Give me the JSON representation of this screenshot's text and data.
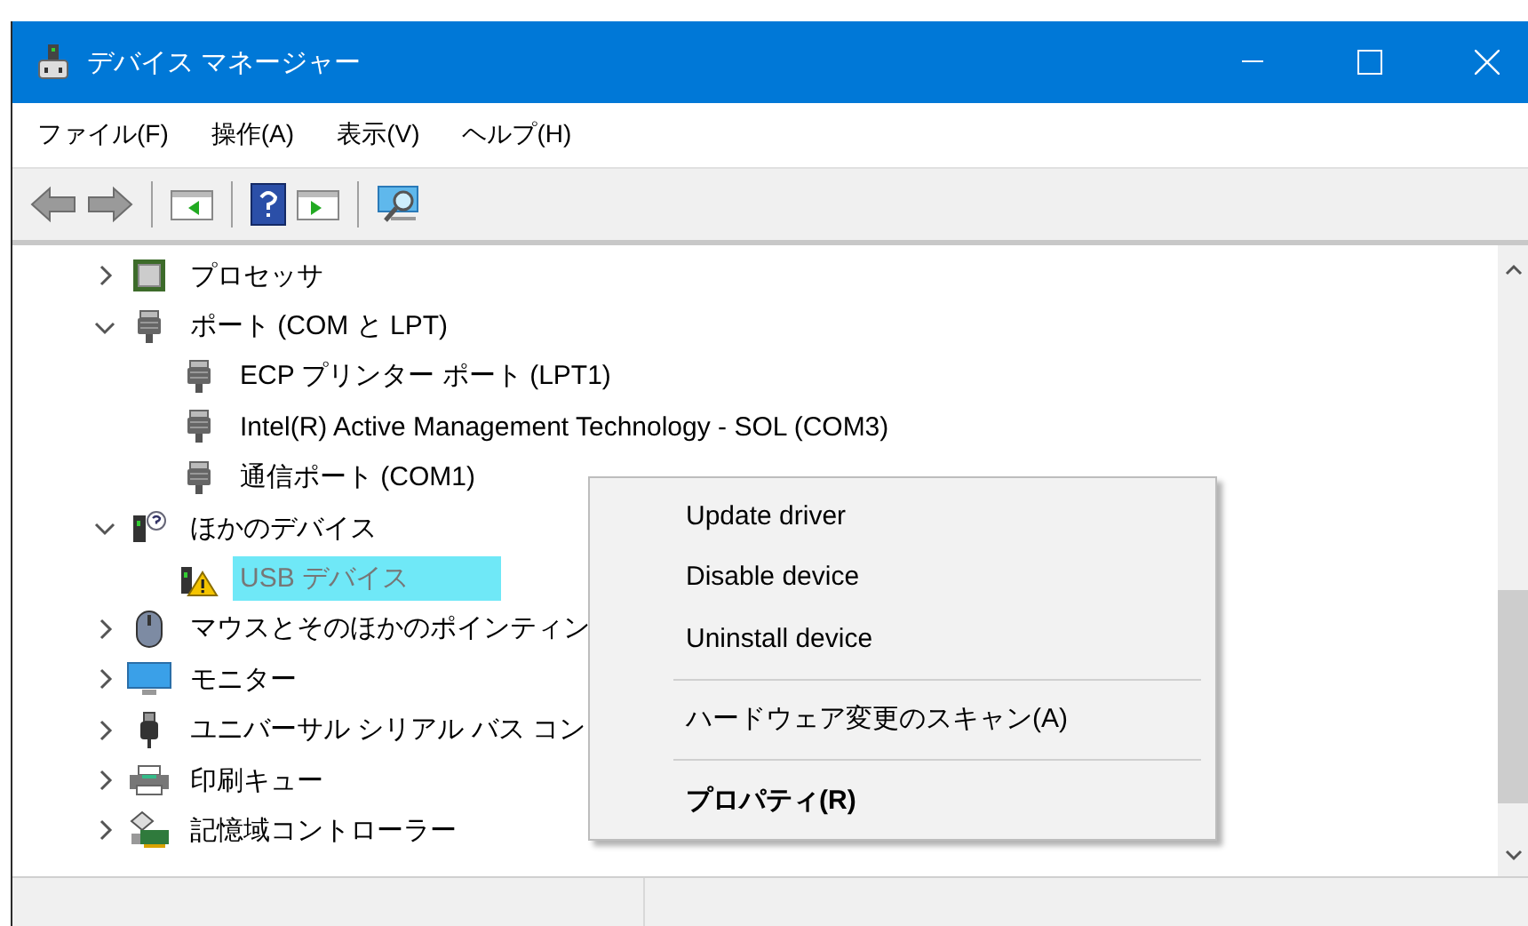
{
  "window": {
    "title": "デバイス マネージャー"
  },
  "menu_bar": [
    {
      "label": "ファイル(F)"
    },
    {
      "label": "操作(A)"
    },
    {
      "label": "表示(V)"
    },
    {
      "label": "ヘルプ(H)"
    }
  ],
  "tree": [
    {
      "label": "プロセッサ",
      "expanded": false,
      "selected": false
    },
    {
      "label": "ポート (COM と LPT)",
      "expanded": true,
      "selected": false,
      "children": [
        {
          "label": "ECP プリンター ポート (LPT1)",
          "selected": false
        },
        {
          "label": "Intel(R) Active Management Technology - SOL (COM3)",
          "selected": false
        },
        {
          "label": "通信ポート (COM1)",
          "selected": false
        }
      ]
    },
    {
      "label": "ほかのデバイス",
      "expanded": true,
      "selected": false,
      "children": [
        {
          "label": "USB デバイス",
          "selected": true
        }
      ]
    },
    {
      "label": "マウスとそのほかのポインティン",
      "expanded": false,
      "selected": false
    },
    {
      "label": "モニター",
      "expanded": false,
      "selected": false
    },
    {
      "label": "ユニバーサル シリアル バス コン",
      "expanded": false,
      "selected": false
    },
    {
      "label": "印刷キュー",
      "expanded": false,
      "selected": false
    },
    {
      "label": "記憶域コントローラー",
      "expanded": false,
      "selected": false
    }
  ],
  "context_menu": [
    {
      "kind": "item",
      "label": "Update driver",
      "bold": false
    },
    {
      "kind": "item",
      "label": "Disable device",
      "bold": false
    },
    {
      "kind": "item",
      "label": "Uninstall device",
      "bold": false
    },
    {
      "kind": "separator"
    },
    {
      "kind": "item",
      "label": "ハードウェア変更のスキャン(A)",
      "bold": false
    },
    {
      "kind": "separator"
    },
    {
      "kind": "item",
      "label": "プロパティ(R)",
      "bold": true
    }
  ]
}
